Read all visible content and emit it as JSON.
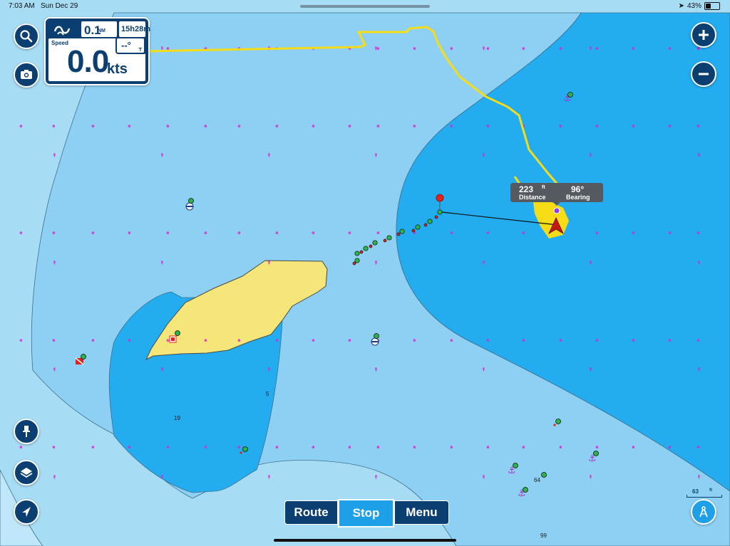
{
  "status_bar": {
    "time": "7:03 AM",
    "date": "Sun Dec 29",
    "battery": "43%"
  },
  "speed_panel": {
    "distance_value": "0.1",
    "distance_unit": "NM",
    "elapsed_time": "15h28m",
    "speed_label": "Speed",
    "speed_value": "0.0",
    "speed_unit": "kts",
    "heading": "--°",
    "heading_ref": "T"
  },
  "callout": {
    "distance_value": "223",
    "distance_unit": "ft",
    "distance_label": "Distance",
    "bearing_value": "96°",
    "bearing_label": "Bearing"
  },
  "bottom_bar": {
    "route_label": "Route",
    "stop_label": "Stop",
    "menu_label": "Menu"
  },
  "scale": {
    "value": "63",
    "unit": "ft"
  },
  "depth_soundings": [
    "5",
    "19",
    "64",
    "99"
  ],
  "icons": {
    "left": [
      "search-icon",
      "camera-icon",
      "pin-icon",
      "layers-icon",
      "locate-icon"
    ],
    "right": [
      "zoom-in-icon",
      "zoom-out-icon",
      "compass-icon"
    ]
  },
  "colors": {
    "deep_water": "#a7dcf5",
    "mid_water": "#8ed0f3",
    "shallow_water": "#23adf0",
    "land": "#f5e67a",
    "track": "#f5dc16",
    "ui_navy": "#0b3f72",
    "ui_active": "#1ea0e8"
  }
}
